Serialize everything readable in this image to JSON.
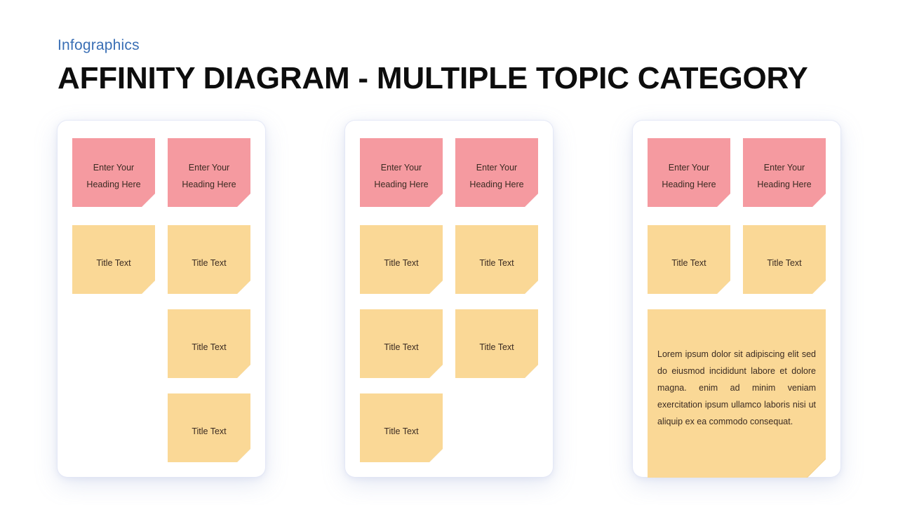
{
  "header": {
    "eyebrow": "Infographics",
    "title": "AFFINITY DIAGRAM - MULTIPLE TOPIC CATEGORY",
    "eyebrow_color": "#3a6fb5",
    "title_color": "#0d0d0d"
  },
  "palette": {
    "note_pink": "#f59aa0",
    "note_pink_fold": "#d4777d",
    "note_yellow": "#fad896",
    "note_yellow_fold": "#ddb86f",
    "panel_background": "#ffffff",
    "page_background": "#ffffff",
    "note_text": "#3b2b22"
  },
  "labels": {
    "heading_line1": "Enter Your",
    "heading_line2": "Heading Here",
    "title_text": "Title Text",
    "lorem": "Lorem ipsum dolor sit adipiscing elit sed do eiusmod incididunt labore et dolore magna. enim ad minim veniam exercitation ipsum ullamco laboris nisi ut aliquip ex ea commodo consequat."
  },
  "columns": [
    {
      "name": "column-1",
      "notes": [
        {
          "kind": "heading",
          "color": "pink",
          "col": "left",
          "row": 1
        },
        {
          "kind": "heading",
          "color": "pink",
          "col": "right",
          "row": 1
        },
        {
          "kind": "title",
          "color": "yellow",
          "col": "left",
          "row": 2
        },
        {
          "kind": "title",
          "color": "yellow",
          "col": "right",
          "row": 2
        },
        {
          "kind": "title",
          "color": "yellow",
          "col": "right",
          "row": 3
        },
        {
          "kind": "title",
          "color": "yellow",
          "col": "right",
          "row": 4
        }
      ]
    },
    {
      "name": "column-2",
      "notes": [
        {
          "kind": "heading",
          "color": "pink",
          "col": "left",
          "row": 1
        },
        {
          "kind": "heading",
          "color": "pink",
          "col": "right",
          "row": 1
        },
        {
          "kind": "title",
          "color": "yellow",
          "col": "left",
          "row": 2
        },
        {
          "kind": "title",
          "color": "yellow",
          "col": "right",
          "row": 2
        },
        {
          "kind": "title",
          "color": "yellow",
          "col": "left",
          "row": 3
        },
        {
          "kind": "title",
          "color": "yellow",
          "col": "right",
          "row": 3
        },
        {
          "kind": "title",
          "color": "yellow",
          "col": "left",
          "row": 4
        }
      ]
    },
    {
      "name": "column-3",
      "notes": [
        {
          "kind": "heading",
          "color": "pink",
          "col": "left",
          "row": 1
        },
        {
          "kind": "heading",
          "color": "pink",
          "col": "right",
          "row": 1
        },
        {
          "kind": "title",
          "color": "yellow",
          "col": "left",
          "row": 2
        },
        {
          "kind": "title",
          "color": "yellow",
          "col": "right",
          "row": 2
        },
        {
          "kind": "lorem",
          "color": "yellow",
          "col": "wide",
          "row": 3
        }
      ]
    }
  ]
}
